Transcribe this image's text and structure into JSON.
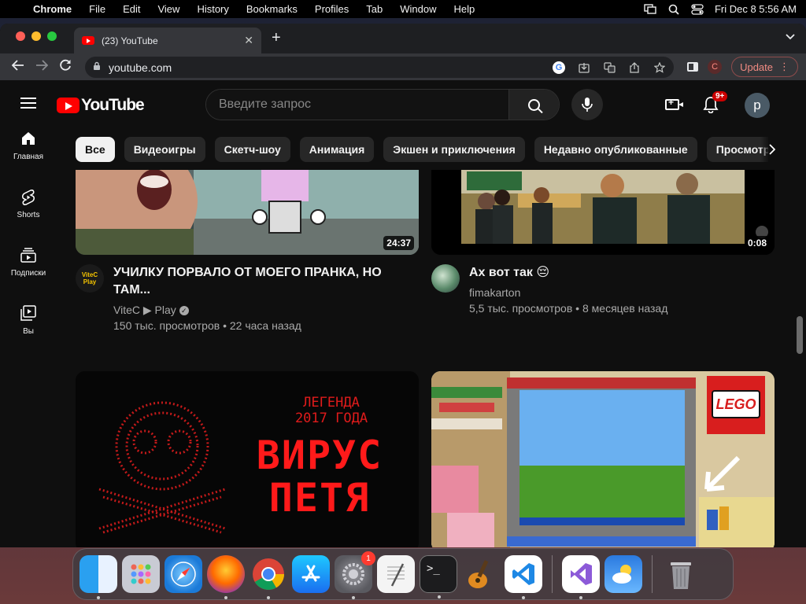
{
  "menubar": {
    "app": "Chrome",
    "items": [
      "File",
      "Edit",
      "View",
      "History",
      "Bookmarks",
      "Profiles",
      "Tab",
      "Window",
      "Help"
    ],
    "clock": "Fri Dec 8  5:56 AM"
  },
  "browser": {
    "tab_title": "(23) YouTube",
    "url": "youtube.com",
    "profile_initial": "C",
    "update_label": "Update"
  },
  "youtube": {
    "logo_text": "YouTube",
    "search_placeholder": "Введите запрос",
    "notifications_badge": "9+",
    "avatar_initial": "p",
    "rail": [
      {
        "icon": "home-icon",
        "label": "Главная"
      },
      {
        "icon": "shorts-icon",
        "label": "Shorts"
      },
      {
        "icon": "subscriptions-icon",
        "label": "Подписки"
      },
      {
        "icon": "you-icon",
        "label": "Вы"
      }
    ],
    "chips": [
      "Все",
      "Видеоигры",
      "Скетч-шоу",
      "Анимация",
      "Экшен и приключения",
      "Недавно опубликованные",
      "Просмотрено"
    ],
    "videos": [
      {
        "title": "УЧИЛКУ ПОРВАЛО ОТ МОЕГО ПРАНКА, НО ТАМ...",
        "channel": "ViteC ▶ Play",
        "verified": true,
        "views": "150 тыс. просмотров",
        "age": "22 часа назад",
        "duration": "24:37",
        "avatar_text": "ViteC Play"
      },
      {
        "title": "Ах вот так 😔",
        "channel": "fimakarton",
        "verified": false,
        "views": "5,5 тыс. просмотров",
        "age": "8 месяцев назад",
        "duration": "0:08"
      },
      {
        "thumb_line1": "ЛЕГЕНДА",
        "thumb_line2": "2017 ГОДА",
        "thumb_big1": "ВИРУС",
        "thumb_big2": "ПЕТЯ"
      },
      {
        "thumb_logo": "LEGO"
      }
    ]
  },
  "dock": {
    "apps": [
      "finder-icon",
      "launchpad-icon",
      "safari-icon",
      "firefox-icon",
      "chrome-icon",
      "app-store-icon",
      "system-settings-icon",
      "textedit-icon",
      "terminal-icon",
      "garageband-icon",
      "vscode-icon",
      "visual-studio-icon",
      "weather-icon",
      "trash-icon"
    ],
    "settings_badge": "1"
  }
}
